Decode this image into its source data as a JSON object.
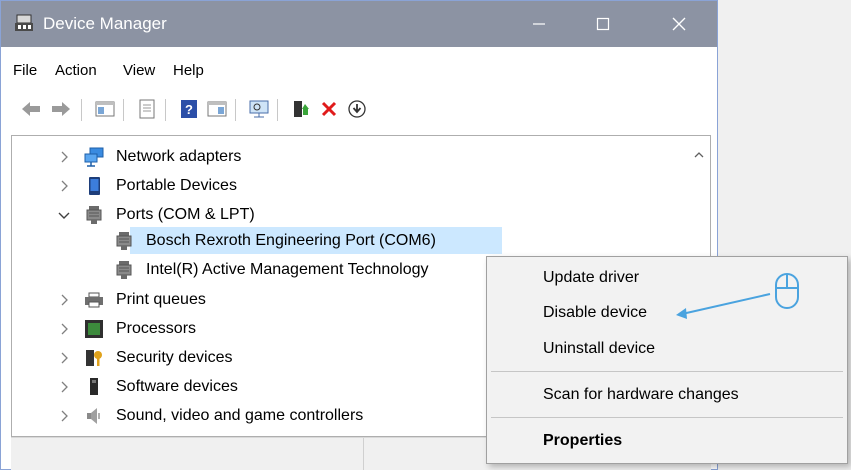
{
  "window": {
    "title": "Device Manager",
    "accent_titlebar": "#8c93a3"
  },
  "menu": [
    "File",
    "Action",
    "View",
    "Help"
  ],
  "toolbar": {
    "icons": [
      "back-arrow-icon",
      "forward-arrow-icon",
      "show-hide-console-tree-icon",
      "properties-sheet-icon",
      "help-icon",
      "action-pane-icon",
      "scan-monitor-icon",
      "enable-device-icon",
      "remove-device-icon",
      "update-driver-icon"
    ]
  },
  "tree": {
    "items": [
      {
        "label": "Network adapters",
        "expanded": false,
        "level": 0
      },
      {
        "label": "Portable Devices",
        "expanded": false,
        "level": 0
      },
      {
        "label": "Ports (COM & LPT)",
        "expanded": true,
        "level": 0
      },
      {
        "label": "Bosch Rexroth Engineering Port (COM6)",
        "level": 1,
        "selected": true
      },
      {
        "label": "Intel(R) Active Management Technology",
        "level": 1
      },
      {
        "label": "Print queues",
        "expanded": false,
        "level": 0
      },
      {
        "label": "Processors",
        "expanded": false,
        "level": 0
      },
      {
        "label": "Security devices",
        "expanded": false,
        "level": 0
      },
      {
        "label": "Software devices",
        "expanded": false,
        "level": 0
      },
      {
        "label": "Sound, video and game controllers",
        "expanded": false,
        "level": 0
      }
    ],
    "selection_color": "#cce8ff"
  },
  "context_menu": {
    "items": [
      {
        "label": "Update driver"
      },
      {
        "label": "Disable device"
      },
      {
        "label": "Uninstall device"
      },
      {
        "label": "Scan for hardware changes"
      },
      {
        "label": "Properties",
        "bold": true
      }
    ]
  },
  "annotation": {
    "arrow_color": "#4aa3df"
  }
}
